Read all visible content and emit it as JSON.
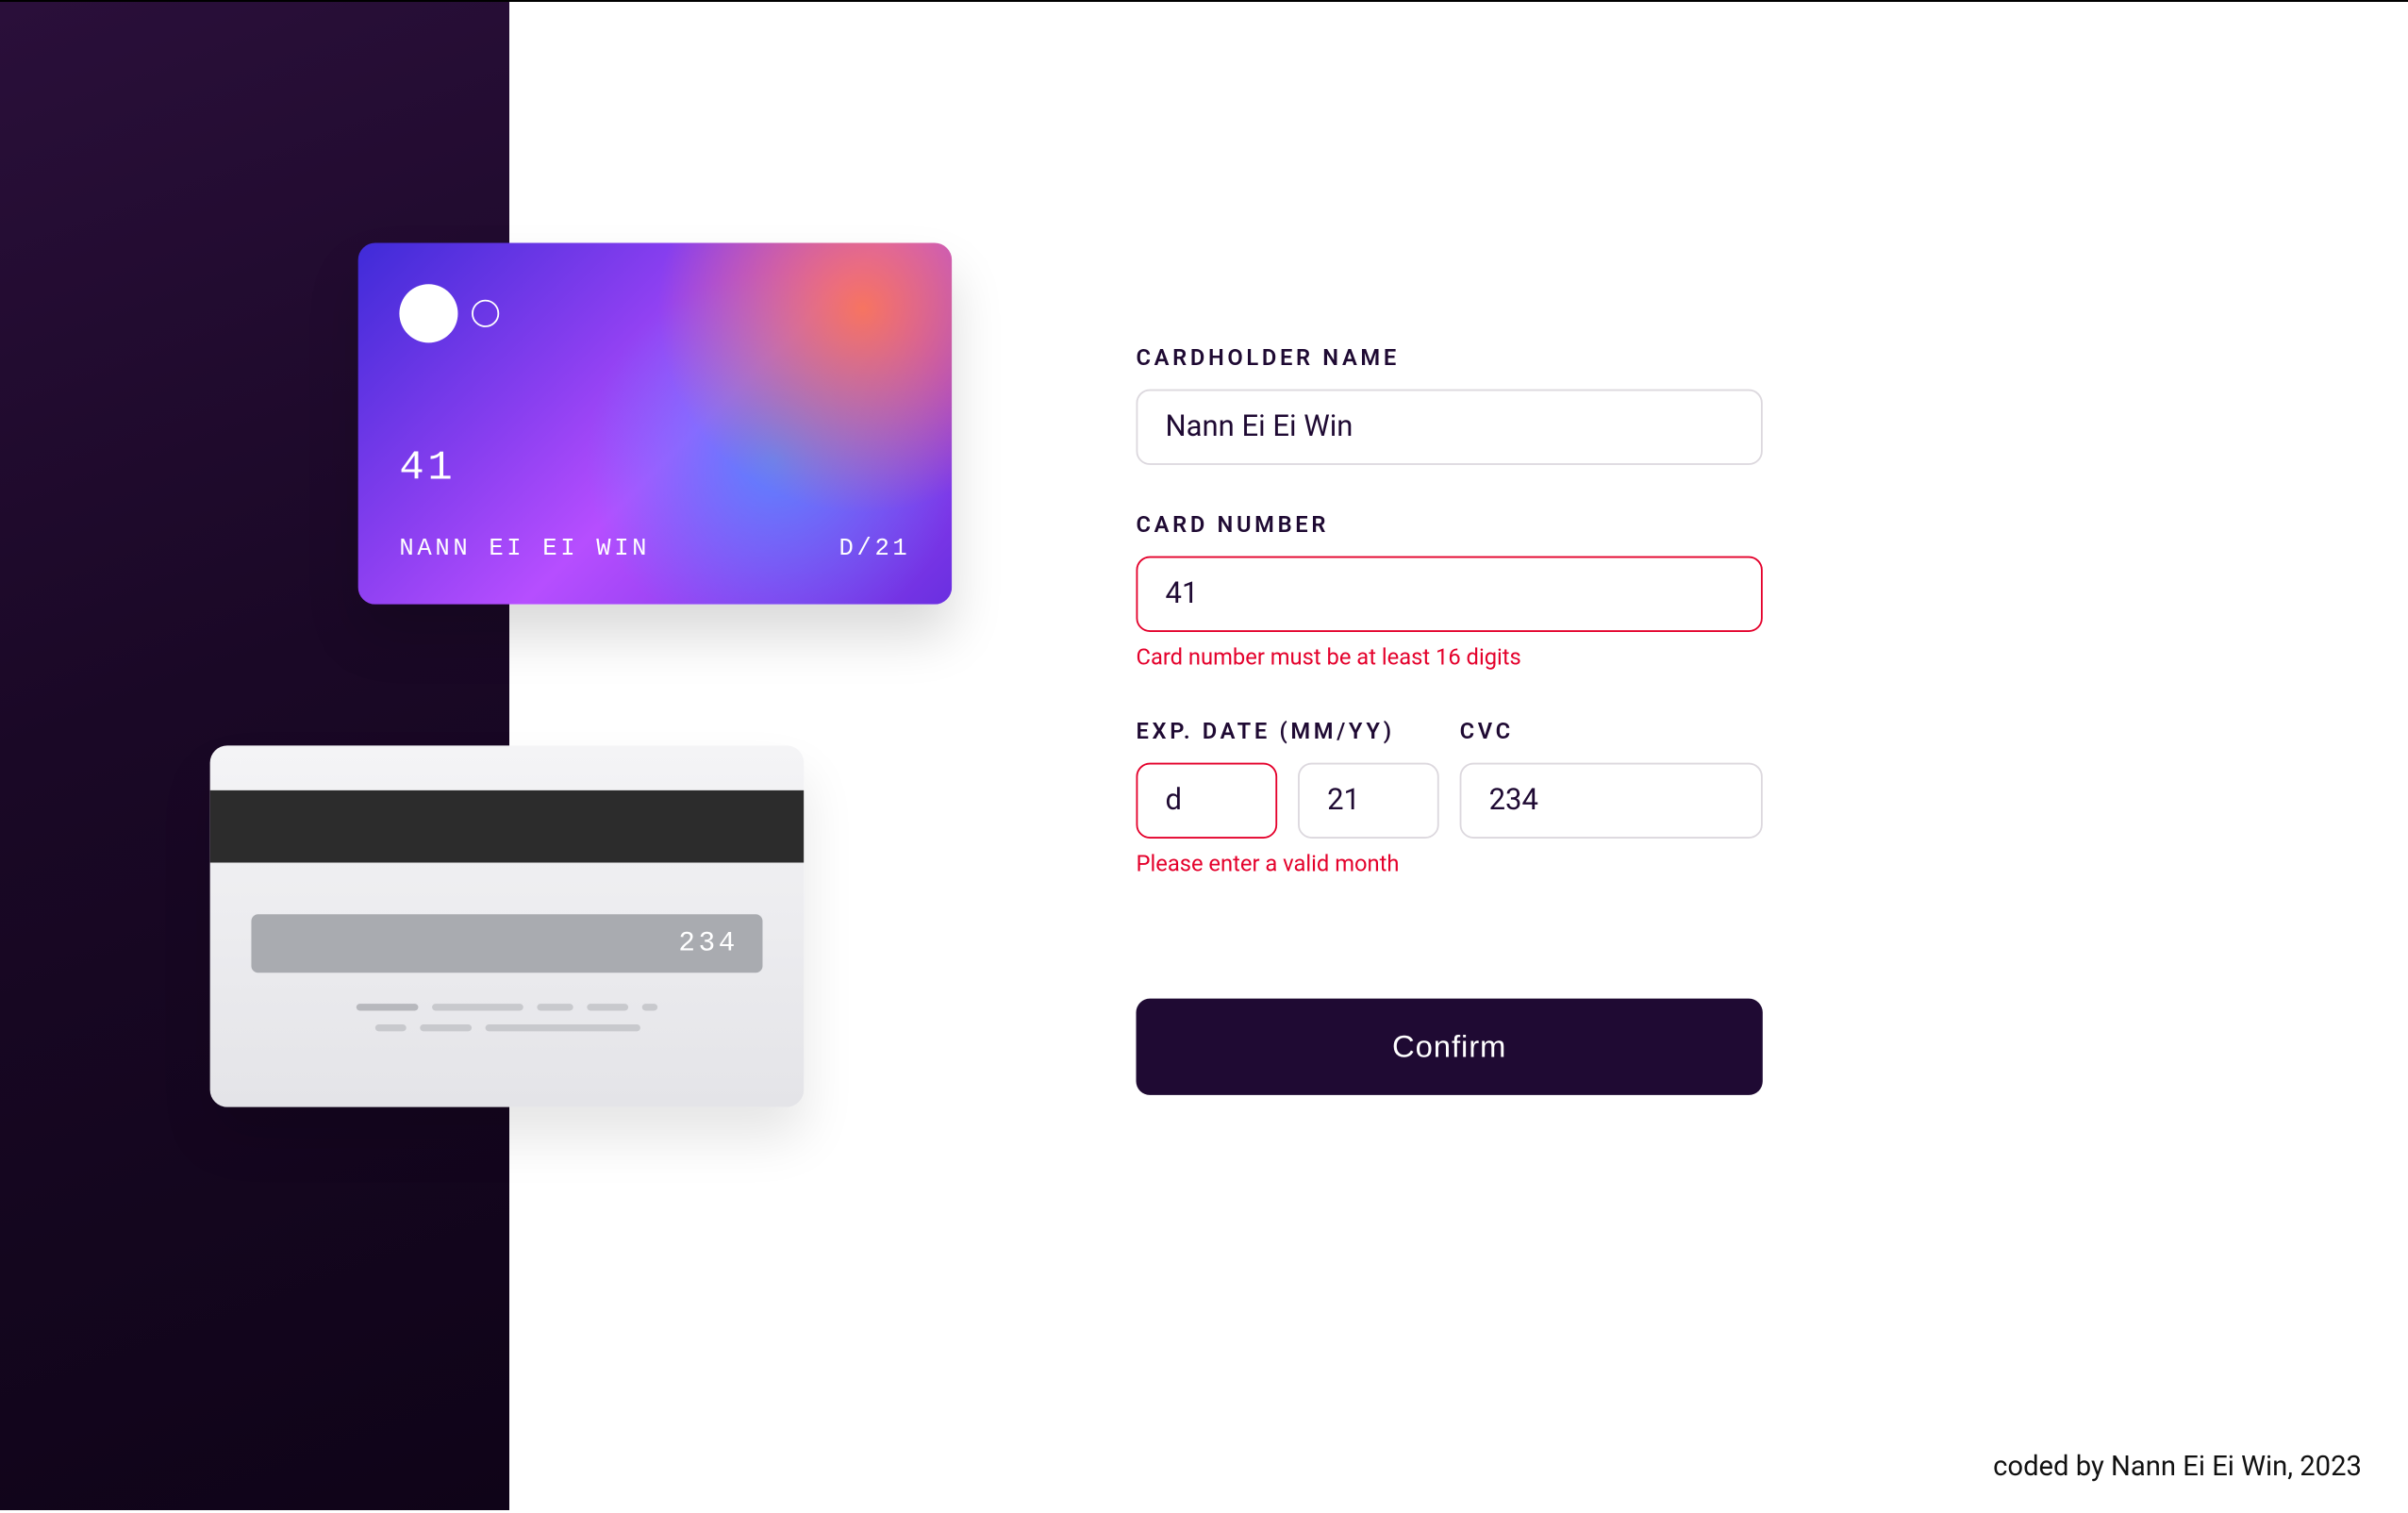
{
  "card": {
    "number_display": "41",
    "name_display": "NANN EI EI WIN",
    "exp_display": "D/21",
    "cvc_display": "234"
  },
  "form": {
    "name": {
      "label": "CARDHOLDER NAME",
      "value": "Nann Ei Ei Win"
    },
    "number": {
      "label": "CARD NUMBER",
      "value": "41",
      "error": "Card number must be at least 16 digits"
    },
    "exp": {
      "label": "EXP. DATE (MM/YY)",
      "mm_value": "d",
      "yy_value": "21",
      "error": "Please enter a valid month"
    },
    "cvc": {
      "label": "CVC",
      "value": "234"
    },
    "confirm_label": "Confirm"
  },
  "footer": {
    "text": "coded by Nann Ei Ei Win, 2023"
  }
}
